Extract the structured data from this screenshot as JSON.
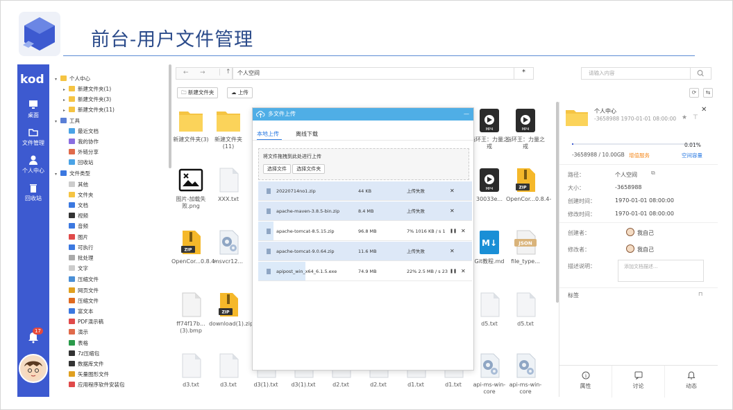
{
  "slide": {
    "title": "前台-用户文件管理"
  },
  "sidebar": {
    "logo": "kod",
    "items": [
      {
        "label": "桌面",
        "icon": "monitor-icon"
      },
      {
        "label": "文件管理",
        "icon": "folder-icon"
      },
      {
        "label": "个人中心",
        "icon": "user-icon"
      },
      {
        "label": "回收站",
        "icon": "trash-icon"
      }
    ],
    "notification_count": "17"
  },
  "tree": [
    {
      "label": "个人中心",
      "level": 0,
      "icon": "folder-icon",
      "color": "#f5c443"
    },
    {
      "label": "新建文件夹(1)",
      "level": 1,
      "icon": "folder-icon",
      "color": "#f5c443"
    },
    {
      "label": "新建文件夹(3)",
      "level": 1,
      "icon": "folder-icon",
      "color": "#f5c443"
    },
    {
      "label": "新建文件夹(11)",
      "level": 1,
      "icon": "folder-icon",
      "color": "#f5c443"
    },
    {
      "label": "工具",
      "level": 0,
      "icon": "wrench-icon",
      "color": "#5a7fd6"
    },
    {
      "label": "最近文档",
      "level": 1,
      "icon": "clock-icon",
      "color": "#4aa3e6"
    },
    {
      "label": "我的协作",
      "level": 1,
      "icon": "collab-icon",
      "color": "#8a6ee0"
    },
    {
      "label": "外链分享",
      "level": 1,
      "icon": "share-icon",
      "color": "#e06a4a"
    },
    {
      "label": "回收站",
      "level": 1,
      "icon": "trash-icon",
      "color": "#4aa3e6"
    },
    {
      "label": "文件类型",
      "level": 0,
      "icon": "grid-icon",
      "color": "#3b78e0"
    },
    {
      "label": "其他",
      "level": 1,
      "icon": "file-icon",
      "color": "#cccccc"
    },
    {
      "label": "文件夹",
      "level": 1,
      "icon": "folder-icon",
      "color": "#f5c443"
    },
    {
      "label": "文档",
      "level": 1,
      "icon": "doc-icon",
      "color": "#3b78e0"
    },
    {
      "label": "视频",
      "level": 1,
      "icon": "video-icon",
      "color": "#333333"
    },
    {
      "label": "音频",
      "level": 1,
      "icon": "music-icon",
      "color": "#3b78e0"
    },
    {
      "label": "图片",
      "level": 1,
      "icon": "image-icon",
      "color": "#e04a4a"
    },
    {
      "label": "可执行",
      "level": 1,
      "icon": "exe-icon",
      "color": "#3b78e0"
    },
    {
      "label": "批处理",
      "level": 1,
      "icon": "batch-icon",
      "color": "#aaaaaa"
    },
    {
      "label": "文字",
      "level": 1,
      "icon": "text-icon",
      "color": "#cccccc"
    },
    {
      "label": "压缩文件",
      "level": 1,
      "icon": "zip-icon",
      "color": "#4a8fd6"
    },
    {
      "label": "网页文件",
      "level": 1,
      "icon": "chrome-icon",
      "color": "#e0a020"
    },
    {
      "label": "压缩文件",
      "level": 1,
      "icon": "zip-icon",
      "color": "#e06a20"
    },
    {
      "label": "富文本",
      "level": 1,
      "icon": "rtf-icon",
      "color": "#3b78e0"
    },
    {
      "label": "PDF演示稿",
      "level": 1,
      "icon": "pdf-icon",
      "color": "#e04a4a"
    },
    {
      "label": "演示",
      "level": 1,
      "icon": "ppt-icon",
      "color": "#e06a4a"
    },
    {
      "label": "表格",
      "level": 1,
      "icon": "excel-icon",
      "color": "#2a9a4a"
    },
    {
      "label": "7z压缩包",
      "level": 1,
      "icon": "7z-icon",
      "color": "#333333"
    },
    {
      "label": "数据库文件",
      "level": 1,
      "icon": "db-icon",
      "color": "#333333"
    },
    {
      "label": "矢量图形文件",
      "level": 1,
      "icon": "vector-icon",
      "color": "#e0a020"
    },
    {
      "label": "应用程序软件安装包",
      "level": 1,
      "icon": "app-icon",
      "color": "#e04a4a"
    }
  ],
  "toolbar": {
    "path": "个人空间",
    "search_placeholder": "请输入内容",
    "new_folder": "新建文件夹",
    "upload": "上传"
  },
  "files": [
    {
      "name": "新建文件夹(3)",
      "type": "folder"
    },
    {
      "name": "新建文件夹(11)",
      "type": "folder"
    },
    {
      "name": "指环王：力量之戒",
      "type": "video"
    },
    {
      "name": "指环王：力量之戒",
      "type": "video"
    },
    {
      "name": "图片-加载失败.png",
      "type": "image"
    },
    {
      "name": "XXX.txt",
      "type": "txt"
    },
    {
      "name": "30033e...",
      "type": "video"
    },
    {
      "name": "OpenCor...0.8.4-",
      "type": "zip"
    },
    {
      "name": "OpenCor...0.8.4-",
      "type": "zip"
    },
    {
      "name": "msvcr12...",
      "type": "gear"
    },
    {
      "name": "Git教程.md",
      "type": "md"
    },
    {
      "name": "file_type...",
      "type": "json"
    },
    {
      "name": "ff74f17b...(3).bmp",
      "type": "bmp"
    },
    {
      "name": "download(1).zip",
      "type": "zip"
    },
    {
      "name": "d5.txt",
      "type": "txt"
    },
    {
      "name": "d5.txt",
      "type": "txt"
    },
    {
      "name": "d3.txt",
      "type": "txt"
    },
    {
      "name": "d3.txt",
      "type": "txt"
    },
    {
      "name": "d3(1).txt",
      "type": "txt"
    },
    {
      "name": "d3(1).txt",
      "type": "txt"
    },
    {
      "name": "d2.txt",
      "type": "txt"
    },
    {
      "name": "d2.txt",
      "type": "txt"
    },
    {
      "name": "d1.txt",
      "type": "txt"
    },
    {
      "name": "d1.txt",
      "type": "txt"
    },
    {
      "name": "api-ms-win-core",
      "type": "gear"
    },
    {
      "name": "api-ms-win-core",
      "type": "gear"
    }
  ],
  "upload_dialog": {
    "title": "多文件上传",
    "tab_local": "本地上传",
    "tab_offline": "离线下载",
    "drop_hint": "将文件拖拽到此处进行上传",
    "btn_select_file": "选择文件",
    "btn_select_folder": "选择文件夹",
    "items": [
      {
        "name": "20220714no1.zip",
        "size": "44 KB",
        "status": "上传失败",
        "progress": 1
      },
      {
        "name": "apache-maven-3.8.5-bin.zip",
        "size": "8.4 MB",
        "status": "上传失败",
        "progress": 1
      },
      {
        "name": "apache-tomcat-8.5.15.zip",
        "size": "96.8 MB",
        "status": "7% 1016 KB / s 1",
        "progress": 0.07
      },
      {
        "name": "apache-tomcat-9.0.64.zip",
        "size": "11.6 MB",
        "status": "上传失败",
        "progress": 1
      },
      {
        "name": "apipost_win_x64_6.1.5.exe",
        "size": "74.9 MB",
        "status": "22% 2.5 MB / s 23",
        "progress": 0.22
      }
    ]
  },
  "detail": {
    "name": "个人中心",
    "sub": "-3658988   1970-01-01 08:00:00",
    "quota_percent": "0.01%",
    "quota_text": "-3658988 / 10.00GB",
    "upgrade": "增值服务",
    "space": "空间容量",
    "props": [
      {
        "k": "路径：",
        "v": "个人空间"
      },
      {
        "k": "大小：",
        "v": "-3658988"
      },
      {
        "k": "创建时间：",
        "v": "1970-01-01 08:00:00"
      },
      {
        "k": "修改时间：",
        "v": "1970-01-01 08:00:00"
      }
    ],
    "creator_label": "创建者：",
    "creator": "我自己",
    "modifier_label": "修改者：",
    "modifier": "我自己",
    "desc_label": "描述说明：",
    "desc_placeholder": "添加文档描述...",
    "tags_label": "标签",
    "tabs": [
      {
        "label": "属性",
        "icon": "info-icon"
      },
      {
        "label": "讨论",
        "icon": "chat-icon"
      },
      {
        "label": "动态",
        "icon": "bell-icon"
      }
    ]
  },
  "colors": {
    "accent": "#3d5ad0",
    "dialog": "#4faee6",
    "warn": "#f58a1f",
    "link": "#2a7ae2"
  }
}
